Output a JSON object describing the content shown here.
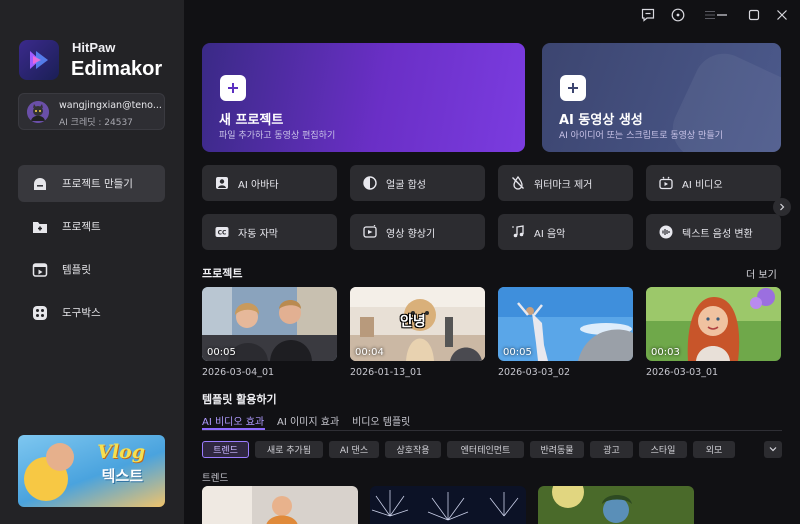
{
  "app": {
    "brand_line1": "HitPaw",
    "brand_line2": "Edimakor"
  },
  "user": {
    "email": "wangjingxian@teno...",
    "credit": "AI 크레딧 : 24537"
  },
  "nav": [
    {
      "label": "프로젝트 만들기",
      "icon": "create-project-icon",
      "active": true
    },
    {
      "label": "프로젝트",
      "icon": "folder-icon",
      "active": false
    },
    {
      "label": "템플릿",
      "icon": "template-icon",
      "active": false
    },
    {
      "label": "도구박스",
      "icon": "toolbox-icon",
      "active": false
    }
  ],
  "promo": {
    "line1": "Vlog",
    "line2": "텍스트"
  },
  "hero": {
    "new_project": {
      "title": "새 프로젝트",
      "subtitle": "파일 추가하고 동영상 편집하기"
    },
    "ai_video": {
      "title": "AI 동영상 생성",
      "subtitle": "AI 아이디어 또는 스크립트로 동영상 만들기"
    }
  },
  "tools": [
    {
      "label": "AI 아바타",
      "icon": "avatar-icon"
    },
    {
      "label": "얼굴 합성",
      "icon": "face-swap-icon"
    },
    {
      "label": "워터마크 제거",
      "icon": "watermark-remove-icon"
    },
    {
      "label": "AI 비디오",
      "icon": "ai-video-icon"
    },
    {
      "label": "자동 자막",
      "icon": "subtitle-icon"
    },
    {
      "label": "영상 향상기",
      "icon": "video-enhance-icon"
    },
    {
      "label": "AI 음악",
      "icon": "music-icon"
    },
    {
      "label": "텍스트 음성 변환",
      "icon": "tts-icon"
    }
  ],
  "projects": {
    "title": "프로젝트",
    "more": "더 보기",
    "items": [
      {
        "name": "2026-03-04_01",
        "duration": "00:05"
      },
      {
        "name": "2026-01-13_01",
        "duration": "00:04",
        "overlay": "안녕"
      },
      {
        "name": "2026-03-03_02",
        "duration": "00:05"
      },
      {
        "name": "2026-03-03_01",
        "duration": "00:03"
      }
    ]
  },
  "templates": {
    "title": "템플릿 활용하기",
    "tabs": [
      "AI 비디오 효과",
      "AI 이미지 효과",
      "비디오 템플릿"
    ],
    "chips": [
      "트렌드",
      "새로 추가됨",
      "AI 댄스",
      "상호작용",
      "엔터테인먼트",
      "반려동물",
      "광고",
      "스타일",
      "외모"
    ],
    "section_label": "트렌드"
  },
  "colors": {
    "accent": "#8e6bff",
    "sidebar_bg": "#232326",
    "main_bg": "#111114",
    "card_bg": "#2c2c30"
  }
}
